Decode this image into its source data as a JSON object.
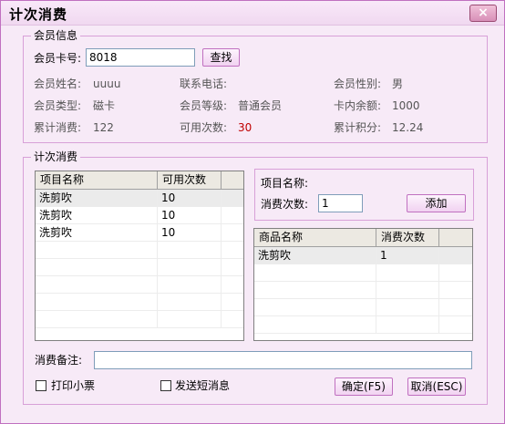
{
  "window": {
    "title": "计次消费",
    "close_icon": "×"
  },
  "member_group": {
    "title": "会员信息",
    "card_label": "会员卡号:",
    "card_value": "8018",
    "find_button": "查找",
    "name_label": "会员姓名:",
    "name_value": "uuuu",
    "phone_label": "联系电话:",
    "phone_value": "",
    "gender_label": "会员性别:",
    "gender_value": "男",
    "type_label": "会员类型:",
    "type_value": "磁卡",
    "level_label": "会员等级:",
    "level_value": "普通会员",
    "balance_label": "卡内余额:",
    "balance_value": "1000",
    "total_label": "累计消费:",
    "total_value": "122",
    "avail_label": "可用次数:",
    "avail_value": "30",
    "points_label": "累计积分:",
    "points_value": "12.24",
    "accent_red": "#c00000"
  },
  "consume_group": {
    "title": "计次消费",
    "items_table": {
      "headers": [
        "项目名称",
        "可用次数"
      ],
      "rows": [
        [
          "洗剪吹",
          "10"
        ],
        [
          "洗剪吹",
          "10"
        ],
        [
          "洗剪吹",
          "10"
        ]
      ]
    },
    "project_label": "项目名称:",
    "count_label": "消费次数:",
    "count_value": "1",
    "add_button": "添加",
    "goods_table": {
      "headers": [
        "商品名称",
        "消费次数"
      ],
      "rows": [
        [
          "洗剪吹",
          "1"
        ]
      ]
    },
    "remark_label": "消费备注:",
    "remark_value": "",
    "print_label": "打印小票",
    "sms_label": "发送短消息",
    "ok_button": "确定(F5)",
    "cancel_button": "取消(ESC)"
  }
}
